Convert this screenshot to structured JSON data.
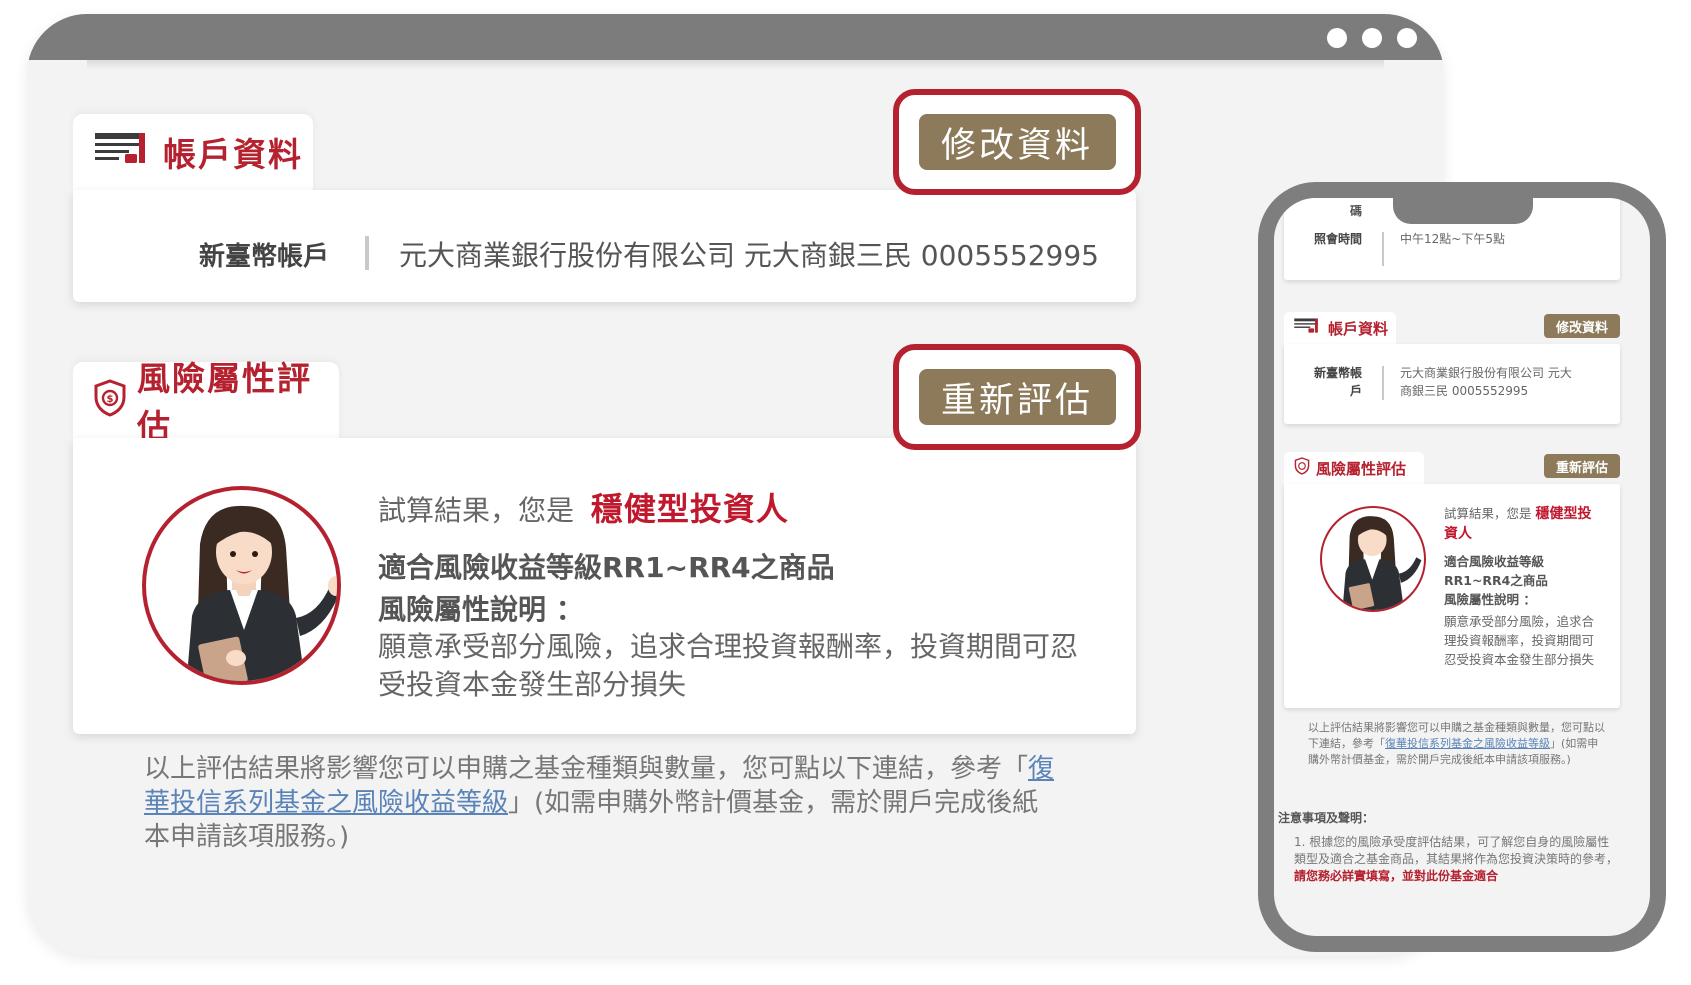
{
  "browser_dots": 3,
  "account_section": {
    "title": "帳戶資料",
    "edit_button": "修改資料",
    "label": "新臺幣帳戶",
    "value": "元大商業銀行股份有限公司 元大商銀三民 0005552995"
  },
  "risk_section": {
    "title": "風險屬性評估",
    "reassess_button": "重新評估",
    "result_prefix": "試算結果，您是",
    "result_type": "穩健型投資人",
    "suitable_products": "適合風險收益等級RR1~RR4之商品",
    "desc_label": "風險屬性說明 ：",
    "desc_text": "願意承受部分風險，追求合理投資報酬率，投資期間可忍受投資本金發生部分損失"
  },
  "note": {
    "before_link": "以上評估結果將影響您可以申購之基金種類與數量，您可點以下連結，參考「",
    "link_text": "復華投信系列基金之風險收益等級",
    "after_link": "」(如需申購外幣計價基金，需於開戶完成後紙本申請該項服務。)"
  },
  "mobile": {
    "top_label_partial": "碼",
    "contact_time_label": "照會時間",
    "contact_time_value": "中午12點~下午5點",
    "account_title": "帳戶資料",
    "edit_button": "修改資料",
    "account_label": "新臺幣帳戶",
    "account_value": "元大商業銀行股份有限公司 元大商銀三民 0005552995",
    "risk_title": "風險屬性評估",
    "reassess_button": "重新評估",
    "result_prefix": "試算結果，您是",
    "result_type": "穩健型投資人",
    "suitable_products": "適合風險收益等級RR1~RR4之商品",
    "desc_label": "風險屬性說明 ：",
    "desc_text": "願意承受部分風險，追求合理投資報酬率，投資期間可忍受投資本金發生部分損失",
    "note_before": "以上評估結果將影響您可以申購之基金種類與數量，您可點以下連結，參考「",
    "note_link": "復華投信系列基金之風險收益等級",
    "note_after": "」(如需申購外幣計價基金，需於開戶完成後紙本申請該項服務。)",
    "notice_title": "注意事項及聲明：",
    "notice_item_1": "1. 根據您的風險承受度評估結果，可了解您自身的風險屬性類型及適合之基金商品，其結果將作為您投資決策時的參考，",
    "notice_item_1_red": "請您務必詳實填寫，並對此份基金適合"
  },
  "colors": {
    "brand_red": "#b5212f",
    "button_gold": "#8c7a5a",
    "frame_gray": "#7c7c7c"
  }
}
